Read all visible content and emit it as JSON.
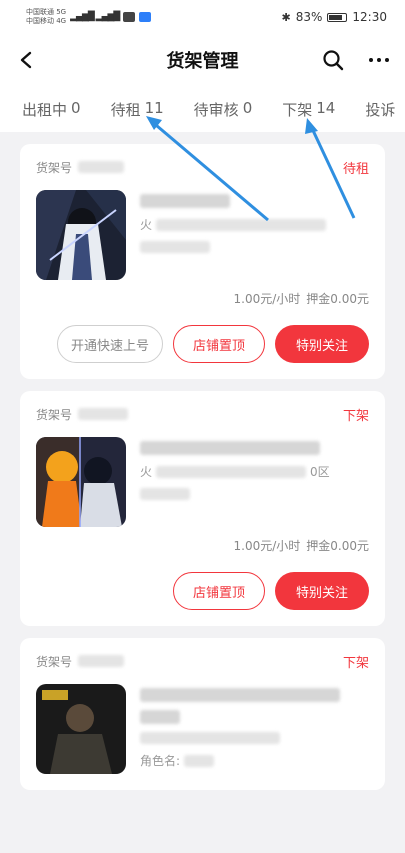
{
  "status_bar": {
    "carrier_line1": "中国联通 5G",
    "carrier_line2": "中国移动 4G",
    "battery_text": "83%",
    "time": "12:30"
  },
  "nav": {
    "title": "货架管理",
    "back_icon": "back-arrow-icon",
    "search_icon": "search-icon",
    "more_icon": "more-icon"
  },
  "tabs": [
    {
      "label": "出租中",
      "count": "0"
    },
    {
      "label": "待租",
      "count": "11"
    },
    {
      "label": "待审核",
      "count": "0"
    },
    {
      "label": "下架",
      "count": "14"
    },
    {
      "label": "投诉",
      "count": ""
    }
  ],
  "cards": [
    {
      "shelf_label": "货架号",
      "status": "待租",
      "title_prefix": "火",
      "price": "1.00元/小时",
      "deposit": "押金0.00元",
      "buttons": [
        "开通快速上号",
        "店铺置顶",
        "特别关注"
      ]
    },
    {
      "shelf_label": "货架号",
      "status": "下架",
      "line2_prefix": "火",
      "line2_suffix": "0区",
      "price": "1.00元/小时",
      "deposit": "押金0.00元",
      "buttons": [
        "店铺置顶",
        "特别关注"
      ]
    },
    {
      "shelf_label": "货架号",
      "status": "下架",
      "role_label": "角色名:"
    }
  ],
  "colors": {
    "accent": "#f2363d",
    "annotation_arrow": "#2f8fe0"
  }
}
